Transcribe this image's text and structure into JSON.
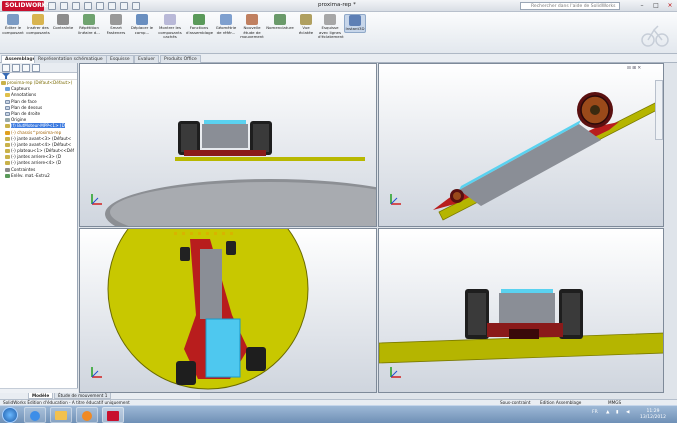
{
  "app": {
    "logo": "SOLIDWORKS",
    "doc_title": "proxima-rep *",
    "search_placeholder": "Rechercher dans l'aide de SolidWorks"
  },
  "commands": [
    {
      "label": "Éditer le composant"
    },
    {
      "label": "Insérer des composants"
    },
    {
      "label": "Contrainte"
    },
    {
      "label": "Répétition linéaire d..."
    },
    {
      "label": "Smart Fasteners"
    },
    {
      "label": "Déplacer le comp..."
    },
    {
      "label": "Montrer les composants cachés"
    },
    {
      "label": "Fonctions d'assemblage"
    },
    {
      "label": "Géométrie de référ..."
    },
    {
      "label": "Nouvelle étude de mouvement"
    },
    {
      "label": "Nomenclature"
    },
    {
      "label": "Vue éclatée"
    },
    {
      "label": "Esquisse avec lignes d'éclatement"
    },
    {
      "label": "Instant3D"
    }
  ],
  "cmd_tabs": [
    "Assemblage",
    "Représentation schématique",
    "Esquisse",
    "Evaluer",
    "Produits Office"
  ],
  "tree": {
    "items": [
      {
        "label": "proxima-rep  (Défaut<Défaut>)"
      },
      {
        "label": "Capteurs"
      },
      {
        "label": "Annotations"
      },
      {
        "label": "Plan de face"
      },
      {
        "label": "Plan de dessus"
      },
      {
        "label": "Plan de droite"
      },
      {
        "label": "Origine"
      },
      {
        "label": "(f) ButMoteur-MPP<1> (D"
      },
      {
        "label": "(-) chassis^proxima-rep"
      },
      {
        "label": "(-) jante avant<3> (Défaut<"
      },
      {
        "label": "(-) jante avant<4> (Défaut<"
      },
      {
        "label": "(-) plateau<1> (Défaut<<Déf"
      },
      {
        "label": "(-) jantes arriere<3> (D"
      },
      {
        "label": "(-) jantes arriere<4> (D"
      },
      {
        "label": "Contraintes"
      },
      {
        "label": "Enlèv. mat.-Extru2"
      }
    ]
  },
  "bottom_tabs": [
    "Modèle",
    "Étude de mouvement 1"
  ],
  "status": {
    "left": "SolidWorks Édition d'éducation - A titre éducatif uniquement",
    "sous": "Sous-contraint",
    "edition": "Edition Assemblage",
    "units": "MMGS"
  },
  "taskbar": {
    "lang": "FR",
    "time": "11:29",
    "date": "13/12/2012"
  },
  "colors": {
    "accent": "#c8102e",
    "viewport_top": "#ffffff",
    "viewport_bottom": "#b9c3d0",
    "plateau": "#c8c800"
  }
}
